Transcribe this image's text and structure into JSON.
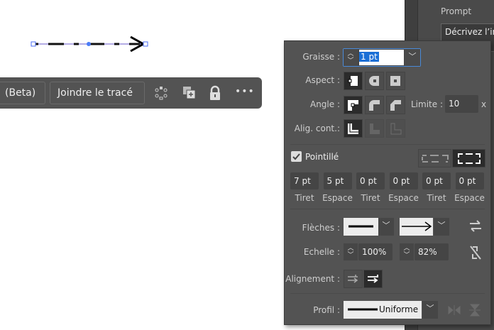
{
  "right_panel": {
    "prompt_label": "Prompt",
    "prompt_placeholder": "Décrivez l’image que vous souhaitez générer"
  },
  "toolbar": {
    "beta_button": "(Beta)",
    "join_path_button": "Joindre le tracé",
    "more": "•••"
  },
  "stroke_panel": {
    "weight_label": "Graisse :",
    "weight_value": "1 pt",
    "cap_label": "Aspect :",
    "corner_label": "Angle :",
    "limit_label": "Limite :",
    "limit_value": "10",
    "limit_unit": "x",
    "align_label": "Alig. cont.:",
    "dashed_label": "Pointillé",
    "dashed_checked": true,
    "dashes": [
      {
        "value": "7 pt",
        "label": "Tiret"
      },
      {
        "value": "5 pt",
        "label": "Espace"
      },
      {
        "value": "0 pt",
        "label": "Tiret"
      },
      {
        "value": "0 pt",
        "label": "Espace"
      },
      {
        "value": "0 pt",
        "label": "Tiret"
      },
      {
        "value": "0 pt",
        "label": "Espace"
      }
    ],
    "arrows_label": "Flèches :",
    "scale_label": "Echelle :",
    "scale_start": "100%",
    "scale_end": "82%",
    "alignment_label": "Alignement :",
    "profile_label": "Profil :",
    "profile_value": "Uniforme"
  }
}
